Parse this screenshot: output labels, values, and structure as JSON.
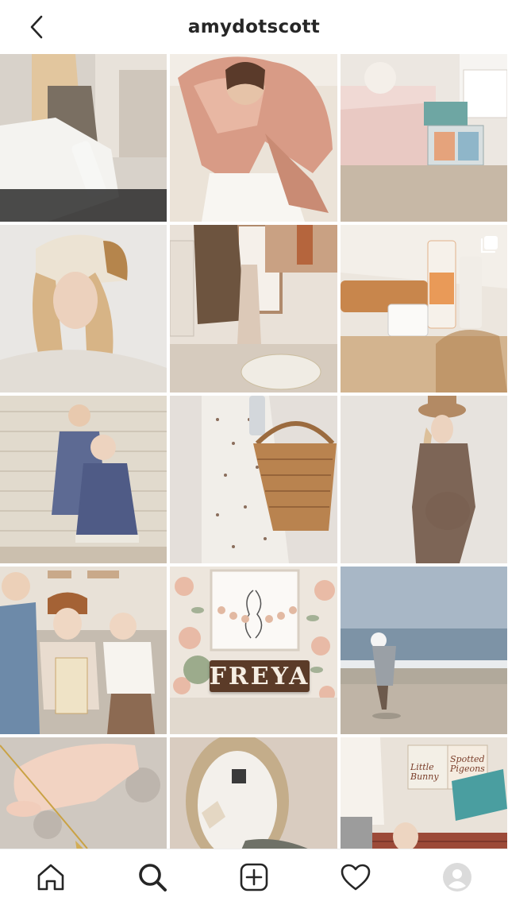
{
  "header": {
    "username": "amydotscott",
    "back_icon": "chevron-left-icon"
  },
  "posts": [
    {
      "subject": "woman-with-bottle"
    },
    {
      "subject": "girl-with-balloon"
    },
    {
      "subject": "bedroom-books"
    },
    {
      "subject": "woman-in-fur-hat"
    },
    {
      "subject": "nursery-window"
    },
    {
      "subject": "skincare-products",
      "multi": true
    },
    {
      "subject": "two-sisters"
    },
    {
      "subject": "basket-dress"
    },
    {
      "subject": "pregnant-woman-hat"
    },
    {
      "subject": "family-on-couch"
    },
    {
      "subject": "freya-sign",
      "sign_text": "FREYA"
    },
    {
      "subject": "child-at-beach"
    },
    {
      "subject": "baby-hand-necklace"
    },
    {
      "subject": "moses-basket"
    },
    {
      "subject": "kids-reading-books",
      "book_titles": [
        "Little Bunny",
        "Spotted Pigeons"
      ]
    }
  ],
  "nav": {
    "items": [
      {
        "icon": "home-icon"
      },
      {
        "icon": "search-icon",
        "active": true
      },
      {
        "icon": "add-post-icon"
      },
      {
        "icon": "heart-icon"
      },
      {
        "icon": "profile-avatar-icon"
      }
    ]
  },
  "colors": {
    "text": "#262626",
    "background": "#ffffff"
  }
}
